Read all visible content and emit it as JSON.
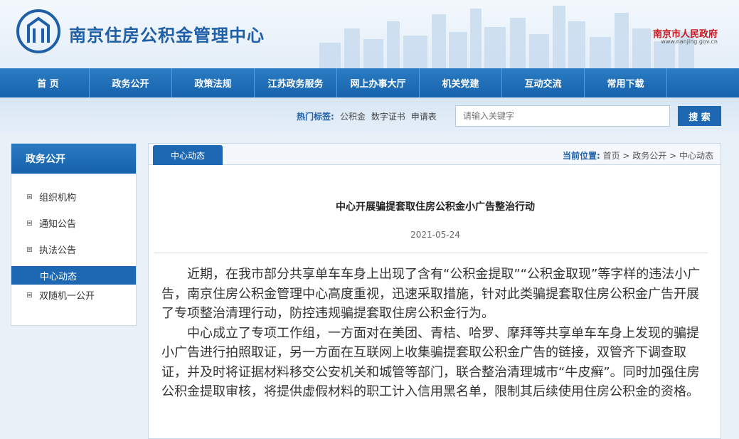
{
  "header": {
    "site_title": "南京住房公积金管理中心",
    "gov_name": "南京市人民政府",
    "gov_url": "www.nanjing.gov.cn"
  },
  "nav": {
    "items": [
      "首 页",
      "政务公开",
      "政策法规",
      "江苏政务服务",
      "网上办事大厅",
      "机关党建",
      "互动交流",
      "常用下载"
    ]
  },
  "search": {
    "hot_label": "热门标签:",
    "hot_tags": [
      "公积金",
      "数字证书",
      "申请表"
    ],
    "placeholder": "请输入关键字",
    "button": "搜 索"
  },
  "sidebar": {
    "title": "政务公开",
    "items": [
      "组织机构",
      "通知公告",
      "执法公告",
      "中心动态",
      "双随机一公开"
    ],
    "active": "中心动态"
  },
  "main": {
    "tab": "中心动态",
    "breadcrumb": {
      "label": "当前位置:",
      "path": [
        "首页",
        "政务公开",
        "中心动态"
      ],
      "sep": " > "
    },
    "article": {
      "title": "中心开展骗提套取住房公积金小广告整治行动",
      "date": "2021-05-24",
      "paragraphs": [
        "近期，在我市部分共享单车车身上出现了含有“公积金提取”“公积金取现”等字样的违法小广告，南京住房公积金管理中心高度重视，迅速采取措施，针对此类骗提套取住房公积金广告开展了专项整治清理行动，防控违规骗提套取住房公积金行为。",
        "中心成立了专项工作组，一方面对在美团、青桔、哈罗、摩拜等共享单车车身上发现的骗提小广告进行拍照取证，另一方面在互联网上收集骗提套取公积金广告的链接，双管齐下调查取证，并及时将证据材料移交公安机关和城管等部门，联合整治清理城市“牛皮癣”。同时加强住房公积金提取审核，将提供虚假材料的职工计入信用黑名单，限制其后续使用住房公积金的资格。"
      ]
    }
  },
  "colors": {
    "primary": "#1e67b2",
    "title_blue": "#1f5fa8",
    "gov_red": "#c8161d"
  }
}
